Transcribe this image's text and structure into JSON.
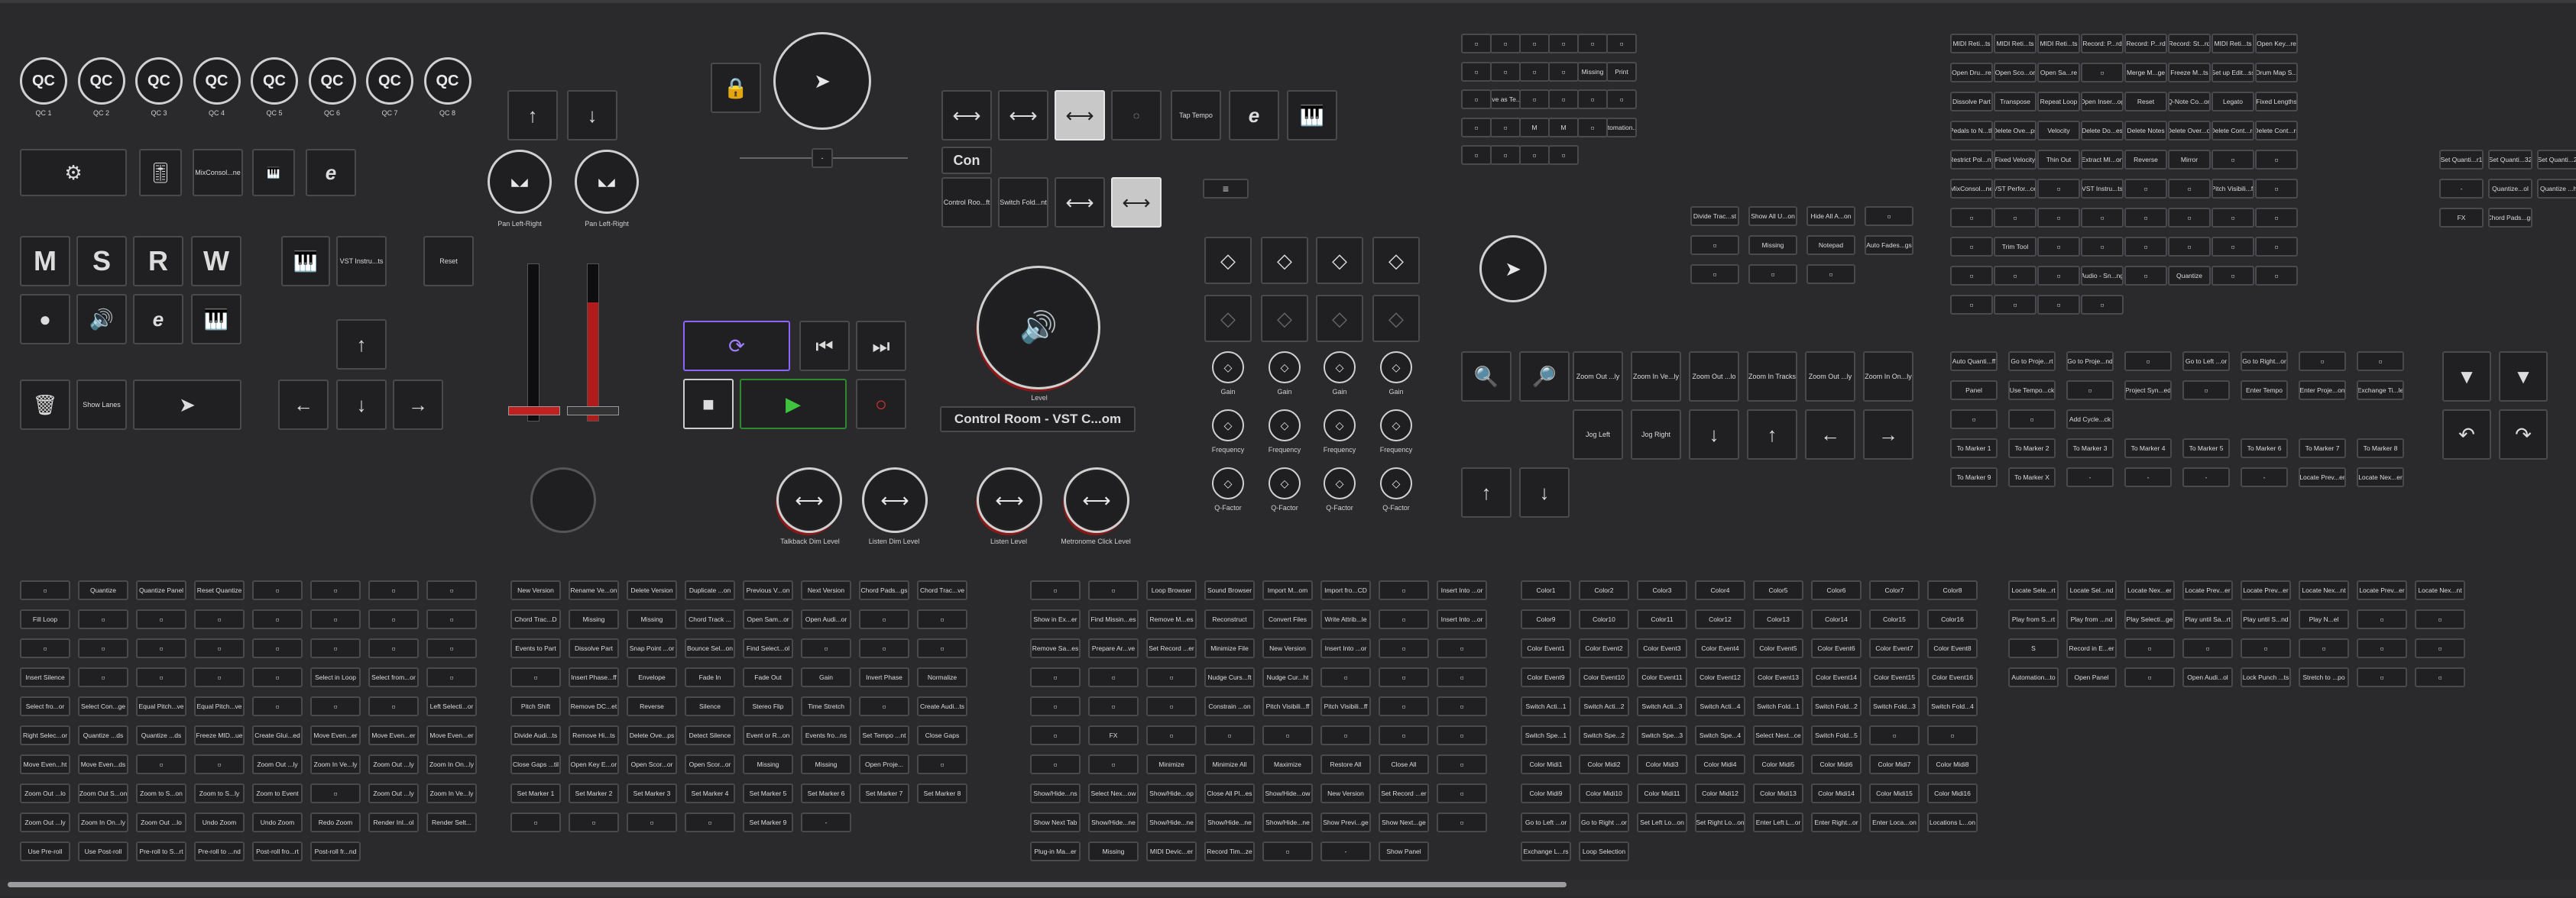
{
  "qc": [
    "QC 1",
    "QC 2",
    "QC 3",
    "QC 4",
    "QC 5",
    "QC 6",
    "QC 7",
    "QC 8"
  ],
  "qc_glyph": "QC",
  "left_buttons": {
    "mixconsole": "MixConsol...ne",
    "vst_instruments": "VST Instru...ts",
    "reset": "Reset",
    "show_lanes": "Show Lanes",
    "mute": "M",
    "solo": "S",
    "read": "R",
    "write": "W"
  },
  "pan": {
    "left": "Pan Left-Right",
    "right": "Pan Left-Right"
  },
  "transport": {
    "con": "Con",
    "control_room": "Control Room - VST C...om",
    "level": "Level",
    "tap_tempo": "Tap Tempo",
    "talkback": "Talkback Dim Level",
    "listen": "Listen Dim Level",
    "listen_level": "Listen Level",
    "metronome": "Metronome Click Level",
    "ctl_room": "Control Roo...ft",
    "switch_fold": "Switch Fold...nt"
  },
  "eq": {
    "gain": "Gain",
    "frequency": "Frequency",
    "qfactor": "Q-Factor"
  },
  "tools_a": [
    "",
    "",
    "",
    "",
    "",
    "",
    "",
    "",
    "",
    "",
    "Missing",
    "Print",
    "",
    "Save as Te...te",
    "",
    "",
    "",
    "",
    "",
    "",
    "M",
    "M",
    "",
    "Automation...to",
    "",
    "",
    "",
    ""
  ],
  "tools_b": [
    "Divide Trac...st",
    "Show All U...on",
    "Hide All A...on",
    "",
    "",
    "Missing",
    "Notepad",
    "Auto Fades...gs",
    "",
    "",
    ""
  ],
  "zoom": [
    "Zoom Out ...ly",
    "Zoom In Ve...ly",
    "Zoom Out ...lo",
    "Zoom In Tracks",
    "Zoom Out ...ly",
    "Zoom In On...ly",
    "Jog Left",
    "Jog Right",
    "Nudge Curs...ft",
    "Nudge Cur...ht"
  ],
  "midi_top": [
    "MIDI Reti...ts",
    "MIDI Reti...ts",
    "MIDI Reti...ts",
    "Record: P...rd",
    "Record: P...rd",
    "Record: St...rd",
    "MIDI Reti...ts",
    "Open Key...re",
    "Open Dru...re",
    "Open Sco...or",
    "Open Sa...re",
    "",
    "Merge M...ge",
    "Freeze M...ts",
    "Set up Edit...ss",
    "Drum Map S...",
    "Dissolve Part",
    "Transpose",
    "Repeat Loop",
    "Open Inser...og",
    "Reset",
    "Q-Note Co...on",
    "Legato",
    "Fixed Lengths",
    "Pedals to N...th",
    "Delete Ove...ps",
    "Velocity",
    "Delete Do...es",
    "Delete Notes",
    "Delete Over...ol",
    "Delete Cont...rs",
    "Delete Cont...rs",
    "Restrict Pol...ny",
    "Fixed Velocity",
    "Thin Out",
    "Extract MI...on",
    "Reverse",
    "Mirror",
    "",
    "",
    "MixConsol...ne",
    "VST Perfor...ce",
    "",
    "VST Instru...ts",
    "",
    "",
    "Pitch Visibili...ff",
    "",
    "",
    "",
    "",
    "",
    "",
    "",
    "",
    "",
    "",
    "Trim Tool",
    "",
    "",
    "",
    "",
    "",
    "",
    "",
    "",
    "",
    "Audio - Sn...ng",
    "",
    "Quantize",
    "",
    "",
    "",
    "",
    "",
    ""
  ],
  "quant": [
    "Set Quanti...r1",
    "Set Quanti...32",
    "Set Quanti...28",
    "-",
    "Quantize...ol",
    "Quantize ...hi",
    "FX",
    "Chord Pads...gs"
  ],
  "locate": [
    "Auto Quanti...ff",
    "Go to Proje...rt",
    "Go to Proje...nd",
    "",
    "Go to Left ...or",
    "Go to Right...or",
    "",
    "",
    "Panel",
    "Use Tempo...ck",
    "",
    "Project Syn...ed",
    "",
    "Enter Tempo",
    "Enter Proje...on",
    "Exchange Ti...le",
    "",
    "",
    "Add Cycle...ck"
  ],
  "markers": [
    "To Marker 1",
    "To Marker 2",
    "To Marker 3",
    "To Marker 4",
    "To Marker 5",
    "To Marker 6",
    "To Marker 7",
    "To Marker 8",
    "To Marker 9",
    "To Marker X",
    "-",
    "-",
    "-",
    "-",
    "Locate Prev...er",
    "Locate Nex...er"
  ],
  "b1": [
    "",
    "Quantize",
    "Quantize Panel",
    "Reset Quantize",
    "",
    "",
    "",
    "",
    "Fill Loop",
    "",
    "",
    "",
    "",
    "",
    "",
    "",
    "",
    "",
    "",
    "",
    "",
    "",
    "",
    "",
    "Insert Silence",
    "",
    "",
    "",
    "",
    "Select in Loop",
    "Select from...or",
    "",
    "Select fro...or",
    "Select Con...ge",
    "Equal Pitch...ve",
    "Equal Pitch...ve",
    "",
    "",
    "",
    "Left Selecti...or",
    "Right Selec...or",
    "Quantize ...ds",
    "Quantize ...ds",
    "Freeze MID...ue",
    "Create Glui...ed",
    "Move Even...er",
    "Move Even...er",
    "Move Even...er",
    "Move Even...ht",
    "Move Even...ds",
    "",
    "",
    "Zoom Out ...ly",
    "Zoom In Ve...ly",
    "Zoom Out ...ly",
    "Zoom In On...ly",
    "Zoom Out ...lo",
    "Zoom Out S...on",
    "Zoom to S...on",
    "Zoom to S...ly",
    "Zoom to Event",
    "",
    "Zoom Out ...ly",
    "Zoom In Ve...ly",
    "Zoom Out ...ly",
    "Zoom In On...ly",
    "Zoom Out ...lo",
    "Undo Zoom",
    "Undo Zoom",
    "Redo Zoom",
    "Render Inl...ol",
    "Render Selt...",
    "Use Pre-roll",
    "Use Post-roll",
    "Pre-roll to S...rt",
    "Pre-roll to ...nd",
    "Post-roll fro...rt",
    "Post-roll fr...nd"
  ],
  "b2": [
    "New Version",
    "Rename Ve...on",
    "Delete Version",
    "Duplicate ...on",
    "Previous V...on",
    "Next Version",
    "Chord Pads...gs",
    "Chord Trac...ve",
    "Chord Trac...D",
    "Missing",
    "Missing",
    "Chord Track ...",
    "Open Sam...or",
    "Open Audi...or",
    "",
    "",
    "Events to Part",
    "Dissolve Part",
    "Snap Point ...or",
    "Bounce Sel...on",
    "Find Select...ol",
    "",
    "",
    "",
    "",
    "Insert Phase...ff",
    "Envelope",
    "Fade In",
    "Fade Out",
    "Gain",
    "Invert Phase",
    "Normalize",
    "Pitch Shift",
    "Remove DC...et",
    "Reverse",
    "Silence",
    "Stereo Flip",
    "Time Stretch",
    "",
    "Create Audi...ts",
    "Divide Audi...ts",
    "Remove Hi...ts",
    "Delete Ove...ps",
    "Detect Silence",
    "Event or R...on",
    "Events fro...ns",
    "Set Tempo ...nt",
    "Close Gaps",
    "Close Gaps ...til",
    "Open Key E...or",
    "Open Scor...or",
    "Open Scor...or",
    "Missing",
    "Missing",
    "Open Proje...",
    "",
    "Set Marker 1",
    "Set Marker 2",
    "Set Marker 3",
    "Set Marker 4",
    "Set Marker 5",
    "Set Marker 6",
    "Set Marker 7",
    "Set Marker 8",
    "",
    "",
    "",
    "",
    "Set Marker 9",
    "-"
  ],
  "b3": [
    "",
    "",
    "Loop Browser",
    "Sound Browser",
    "Import M...om",
    "Import fro...CD",
    "",
    "Insert Into ...or",
    "Show in Ex...er",
    "Find Missin...es",
    "Remove M...es",
    "Reconstruct",
    "Convert Files",
    "Write Attrib...le",
    "",
    "Insert Into ...or",
    "Remove Sa...es",
    "Prepare Ar...ve",
    "Set Record ...er",
    "Minimize File",
    "New Version",
    "Insert Into ...or",
    "",
    "",
    "",
    "",
    "",
    "Nudge Curs...ft",
    "Nudge Cur...ht",
    "",
    "",
    "",
    "",
    "",
    "",
    "Constrain ...on",
    "Pitch Visibili...ff",
    "Pitch Visibili...ff",
    "",
    "",
    "",
    "FX",
    "",
    "",
    "",
    "",
    "",
    "",
    "",
    "",
    "Minimize",
    "Minimize All",
    "Maximize",
    "Restore All",
    "Close All",
    "",
    "Show/Hide...ns",
    "Select Nex...ow",
    "Show/Hide...op",
    "Close All Pl...es",
    "Show/Hide...ow",
    "New Version",
    "Set Record ...er",
    "",
    "Show Next Tab",
    "Show/Hide...ne",
    "Show/Hide...ne",
    "Show/Hide...ne",
    "Show/Hide...ne",
    "Show Previ...ge",
    "Show Next...ge",
    "",
    "Plug-in Ma...er",
    "Missing",
    "MIDI Devic...er",
    "Record Tim...ze",
    "",
    "-",
    "Show Panel"
  ],
  "colors": [
    "Color1",
    "Color2",
    "Color3",
    "Color4",
    "Color5",
    "Color6",
    "Color7",
    "Color8",
    "Color9",
    "Color10",
    "Color11",
    "Color12",
    "Color13",
    "Color14",
    "Color15",
    "Color16",
    "Color Event1",
    "Color Event2",
    "Color Event3",
    "Color Event4",
    "Color Event5",
    "Color Event6",
    "Color Event7",
    "Color Event8",
    "Color Event9",
    "Color Event10",
    "Color Event11",
    "Color Event12",
    "Color Event13",
    "Color Event14",
    "Color Event15",
    "Color Event16",
    "Switch Acti...1",
    "Switch Acti...2",
    "Switch Acti...3",
    "Switch Acti...4",
    "Switch Fold...1",
    "Switch Fold...2",
    "Switch Fold...3",
    "Switch Fold...4",
    "Switch Spe...1",
    "Switch Spe...2",
    "Switch Spe...3",
    "Switch Spe...4",
    "Select Next...ce",
    "Switch Fold...5",
    "",
    "",
    "Color Midi1",
    "Color Midi2",
    "Color Midi3",
    "Color Midi4",
    "Color Midi5",
    "Color Midi6",
    "Color Midi7",
    "Color Midi8",
    "Color Midi9",
    "Color Midi10",
    "Color Midi11",
    "Color Midi12",
    "Color Midi13",
    "Color Midi14",
    "Color Midi15",
    "Color Midi16",
    "Go to Left ...or",
    "Go to Right ...or",
    "Set Left Lo...on",
    "Set Right Lo...on",
    "Enter Left L...or",
    "Enter Right...or",
    "Enter Loca...on",
    "Locations L...on",
    "Exchange L...rs",
    "Loop Selection"
  ],
  "b5": [
    "Locate Sele...rt",
    "Locate Sel...nd",
    "Locate Nex...er",
    "Locate Prev...er",
    "Locate Prev...er",
    "Locate Nex...nt",
    "Locate Prev...er",
    "Locate Nex...nt",
    "Play from S...rt",
    "Play from ...nd",
    "Play Selecti...ge",
    "Play until Sa...rt",
    "Play until S...nd",
    "Play N...el",
    "",
    "",
    "S",
    "Record in E...er",
    "",
    "",
    "",
    "",
    "",
    "",
    "Automation...to",
    "Open Panel",
    "",
    "Open Audi...ol",
    "Lock Punch ...ts",
    "Stretch to ...po",
    "",
    ""
  ],
  "icon_names": [
    "search-icon",
    "gear-icon",
    "lock-icon",
    "pointer-icon",
    "speaker-icon",
    "trash-icon",
    "arrow-up-icon",
    "arrow-down-icon",
    "arrow-left-icon",
    "arrow-right-icon",
    "play-icon",
    "stop-icon",
    "record-icon",
    "cycle-icon",
    "close-icon",
    "zoom-in-icon",
    "zoom-out-icon",
    "undo-icon",
    "redo-icon"
  ]
}
